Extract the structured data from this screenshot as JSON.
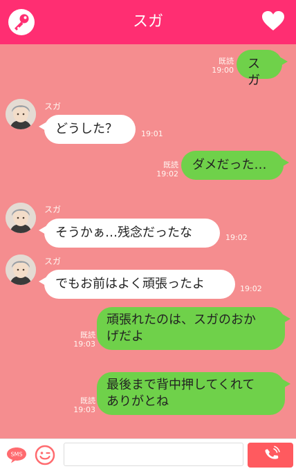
{
  "header": {
    "title": "スガ",
    "key_icon": "key-icon",
    "heart_icon": "heart-icon"
  },
  "contact": {
    "name": "スガ"
  },
  "messages": [
    {
      "from": "me",
      "text": "スガ",
      "read": "既読",
      "time": "19:00"
    },
    {
      "from": "them",
      "sender": "スガ",
      "text": "どうした？",
      "time": "19:01"
    },
    {
      "from": "me",
      "text": "ダメだった…",
      "read": "既読",
      "time": "19:02"
    },
    {
      "from": "them",
      "sender": "スガ",
      "text": "そうかぁ…残念だったな",
      "time": "19:02"
    },
    {
      "from": "them",
      "sender": "スガ",
      "text": "でもお前はよく頑張ったよ",
      "time": "19:02"
    },
    {
      "from": "me",
      "text": "頑張れたのは、スガのおかげだよ",
      "line1": "頑張れたのは、スガのおか",
      "line2": "げだよ",
      "read": "既読",
      "time": "19:03"
    },
    {
      "from": "me",
      "text": "最後まで背中押してくれてありがとね",
      "line1": "最後まで背中押してくれて",
      "line2": "ありがとね",
      "read": "既読",
      "time": "19:03"
    }
  ],
  "footer": {
    "sms_label": "SMS",
    "smile_icon": "smile-icon",
    "input_value": "",
    "input_placeholder": "",
    "send_icon": "phone-icon"
  },
  "colors": {
    "header": "#ff2e72",
    "background": "#f58d8f",
    "bubble_out": "#6fd14a",
    "bubble_in": "#ffffff",
    "send_button": "#ff5a5f"
  }
}
